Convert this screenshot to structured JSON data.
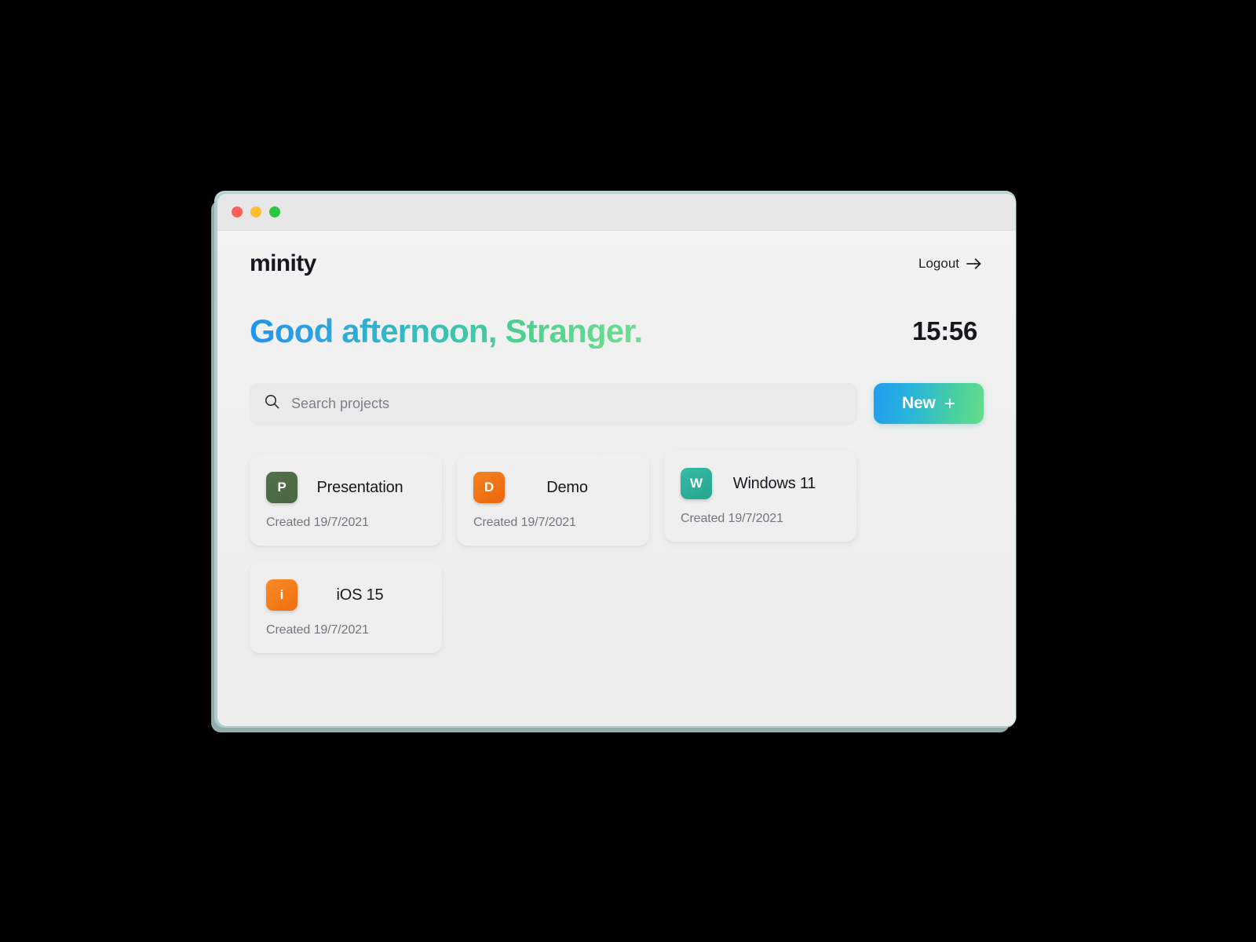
{
  "window": {
    "traffic_lights": [
      {
        "name": "close",
        "color": "#ff5f57"
      },
      {
        "name": "minimize",
        "color": "#febc2e"
      },
      {
        "name": "maximize",
        "color": "#28c840"
      }
    ]
  },
  "header": {
    "brand": "minity",
    "logout_label": "Logout",
    "logout_icon": "arrow-right-icon"
  },
  "hero": {
    "greeting": "Good afternoon, Stranger.",
    "clock": "15:56",
    "gradient_from": "#1e95ef",
    "gradient_to": "#6ede8d"
  },
  "search": {
    "icon": "search-icon",
    "placeholder": "Search projects",
    "value": ""
  },
  "actions": {
    "new_label": "New",
    "new_icon": "plus-icon",
    "new_gradient_from": "#1e9cf0",
    "new_gradient_to": "#65dd8a"
  },
  "projects": [
    {
      "initial": "P",
      "title": "Presentation",
      "created": "Created 19/7/2021",
      "tile_color": "#4f6b45",
      "tile_color_to": "#55733f"
    },
    {
      "initial": "D",
      "title": "Demo",
      "created": "Created 19/7/2021",
      "tile_color": "#f07818",
      "tile_color_to": "#ef6a14"
    },
    {
      "initial": "W",
      "title": "Windows 11",
      "created": "Created 19/7/2021",
      "tile_color": "#31b39c",
      "tile_color_to": "#2bab93"
    },
    {
      "initial": "i",
      "title": "iOS 15",
      "created": "Created 19/7/2021",
      "tile_color": "#f58220",
      "tile_color_to": "#f07212"
    }
  ]
}
